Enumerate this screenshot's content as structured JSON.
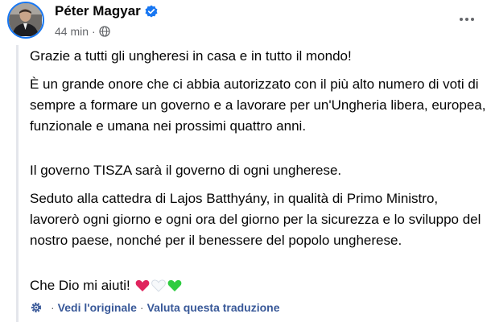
{
  "post": {
    "author": "Péter Magyar",
    "time": "44 min",
    "separator": "·",
    "paragraphs": [
      "Grazie a tutti gli ungheresi in casa e in tutto il mondo!",
      "È un grande onore che ci abbia autorizzato con il più alto numero di voti di sempre a formare un governo e a lavorare per un'Ungheria libera, europea, funzionale e umana nei prossimi quattro anni.",
      "Il governo TISZA sarà il governo di ogni ungherese.",
      "Seduto alla cattedra di Lajos Batthyány, in qualità di Primo Ministro, lavorerò ogni giorno e ogni ora del giorno per la sicurezza e lo sviluppo del nostro paese, nonché per il benessere del popolo ungherese.",
      "Che Dio mi aiuti!"
    ],
    "emoji_icons": [
      "red-heart",
      "white-heart",
      "green-heart"
    ]
  },
  "translation_bar": {
    "dot": "·",
    "see_original": "Vedi l'originale",
    "rate_translation": "Valuta questa traduzione"
  },
  "colors": {
    "verified_blue": "#1877f2",
    "meta_gray": "#65676b",
    "link_blue": "#385898",
    "heart_red": "#e0245e",
    "heart_green": "#2ecc40"
  }
}
